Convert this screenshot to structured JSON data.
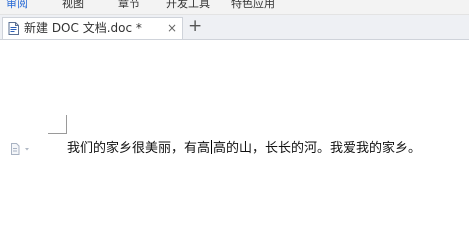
{
  "menu": {
    "items": [
      "审阅",
      "视图",
      "章节",
      "开发工具",
      "特色应用"
    ],
    "active_index": 0
  },
  "tabs": {
    "document_title": "新建 DOC 文档.doc *",
    "close_glyph": "×",
    "new_tab_glyph": "+"
  },
  "document": {
    "text_before_caret": "我们的家乡很美丽，有高",
    "text_after_caret": "高的山，长长的河。我爱我的家乡。"
  },
  "colors": {
    "active_menu": "#2b6cd6",
    "tab_bar_bg": "#eef0f4",
    "menu_bar_bg": "#f3f3f3"
  },
  "icons": {
    "document_tab": "doc-file-icon",
    "paragraph_handle": "paragraph-handle-icon"
  }
}
